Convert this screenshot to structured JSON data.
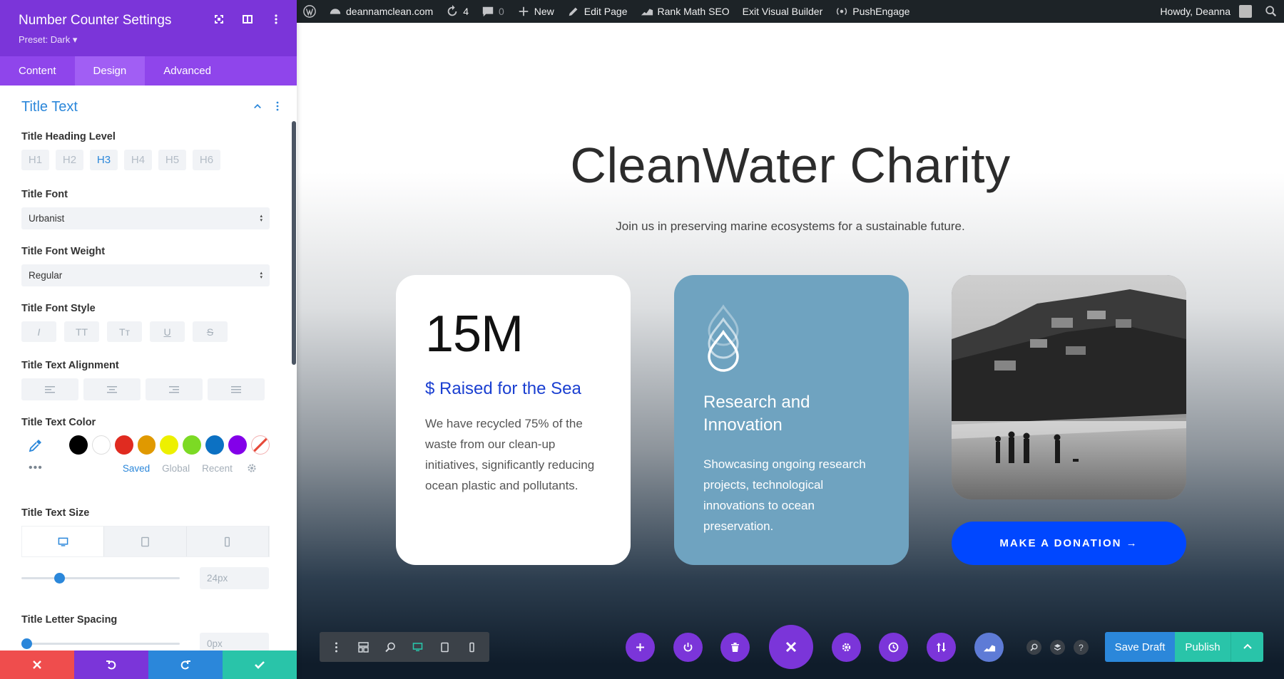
{
  "admin_bar": {
    "site": "deannamclean.com",
    "updates_count": "4",
    "comments_count": "0",
    "new_label": "New",
    "edit_label": "Edit Page",
    "rankmath_label": "Rank Math SEO",
    "exit_label": "Exit Visual Builder",
    "push_label": "PushEngage",
    "howdy": "Howdy, Deanna"
  },
  "panel": {
    "title": "Number Counter Settings",
    "preset": "Preset: Dark ▾",
    "tabs": [
      "Content",
      "Design",
      "Advanced"
    ],
    "active_tab": "Design",
    "section_title": "Title Text",
    "heading_level": {
      "label": "Title Heading Level",
      "options": [
        "H1",
        "H2",
        "H3",
        "H4",
        "H5",
        "H6"
      ],
      "selected": "H3"
    },
    "font": {
      "label": "Title Font",
      "value": "Urbanist"
    },
    "font_weight": {
      "label": "Title Font Weight",
      "value": "Regular"
    },
    "font_style": {
      "label": "Title Font Style",
      "options": [
        "I",
        "TT",
        "Tт",
        "U",
        "S"
      ]
    },
    "alignment": {
      "label": "Title Text Alignment"
    },
    "text_color": {
      "label": "Title Text Color",
      "swatches": [
        "#000000",
        "#ffffff",
        "#e02b20",
        "#e09900",
        "#edf000",
        "#7cda24",
        "#0c71c3",
        "#8300e9"
      ],
      "tabs": [
        "Saved",
        "Global",
        "Recent"
      ],
      "active_tab": "Saved"
    },
    "text_size": {
      "label": "Title Text Size",
      "value": "24px",
      "fraction": 0.22
    },
    "letter_spacing": {
      "label": "Title Letter Spacing",
      "value": "0px",
      "fraction": 0.0
    }
  },
  "page": {
    "title": "CleanWater Charity",
    "subtitle": "Join us in preserving marine ecosystems for a sustainable future.",
    "counter_value": "15M",
    "counter_title": "$ Raised for the Sea",
    "card1_desc": "We have recycled 75% of the waste from our clean-up initiatives, significantly reducing ocean plastic and pollutants.",
    "card2_title": "Research and Innovation",
    "card2_desc": "Showcasing ongoing research projects, technological innovations to ocean preservation.",
    "donate_label": "MAKE A DONATION →"
  },
  "builder": {
    "save_draft": "Save Draft",
    "publish": "Publish",
    "help": "?"
  },
  "colors": {
    "purple": "#7b35d9",
    "blue": "#2b87da",
    "teal": "#29c4a9",
    "red": "#ef4d4d",
    "donate": "#0047ff",
    "card2": "#6fa3c0"
  }
}
